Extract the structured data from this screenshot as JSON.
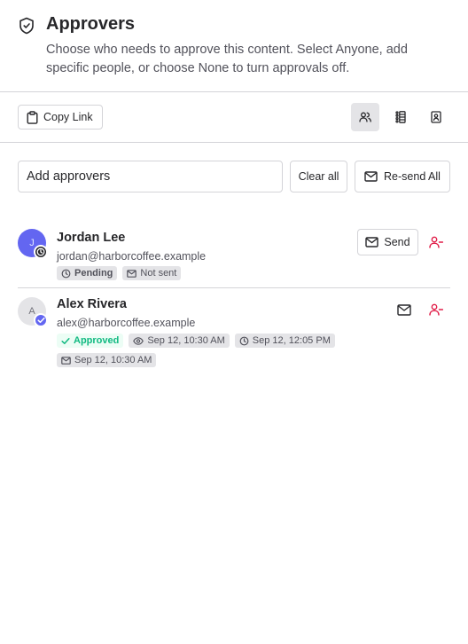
{
  "header": {
    "title": "Approvers",
    "description": "Choose who needs to approve this content. Select Anyone, add specific people, or choose None to turn approvals off.",
    "icon": "shield-check-icon"
  },
  "toolbar": {
    "copy_link_label": "Copy Link",
    "views": [
      {
        "icon": "people-icon",
        "active": true
      },
      {
        "icon": "list-icon",
        "active": false
      },
      {
        "icon": "contact-card-icon",
        "active": false
      }
    ]
  },
  "add": {
    "placeholder": "Add approvers",
    "clear_label": "Clear all",
    "resend_label": "Re-send All"
  },
  "approvers": [
    {
      "initial": "J",
      "name": "Jordan Lee",
      "email": "jordan@harborcoffee.example",
      "status": "Pending",
      "sent": "Not sent",
      "send_label": "Send"
    },
    {
      "initial": "A",
      "name": "Alex Rivera",
      "email": "alex@harborcoffee.example",
      "status": "Approved",
      "viewed": "Sep 12, 10:30 AM",
      "approved_at": "Sep 12, 12:05 PM",
      "sent": "Sep 12, 10:30 AM"
    }
  ],
  "colors": {
    "accent": "#6366f1",
    "approved": "#10b981",
    "remove": "#e11d48",
    "border": "#d4d4d8"
  }
}
